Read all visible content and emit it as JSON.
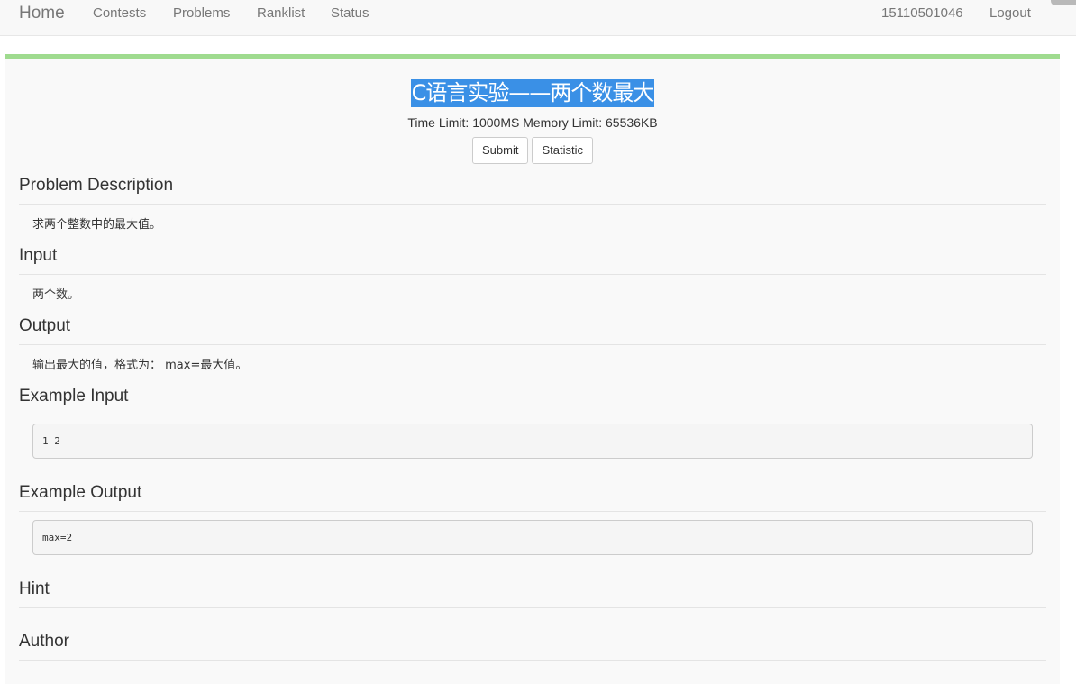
{
  "nav": {
    "brand": "Home",
    "links": [
      "Contests",
      "Problems",
      "Ranklist",
      "Status"
    ],
    "user": "15110501046",
    "logout": "Logout"
  },
  "problem": {
    "title": "C语言实验——两个数最大",
    "limits": "Time Limit: 1000MS Memory Limit: 65536KB",
    "buttons": {
      "submit": "Submit",
      "statistic": "Statistic"
    },
    "sections": {
      "description": {
        "heading": "Problem Description",
        "text": "求两个整数中的最大值。"
      },
      "input": {
        "heading": "Input",
        "text": "两个数。"
      },
      "output": {
        "heading": "Output",
        "text": "输出最大的值，格式为： max=最大值。"
      },
      "example_input": {
        "heading": "Example Input",
        "code": "1 2"
      },
      "example_output": {
        "heading": "Example Output",
        "code": "max=2"
      },
      "hint": {
        "heading": "Hint"
      },
      "author": {
        "heading": "Author"
      }
    }
  },
  "colors": {
    "accent_bar": "#9fdb8f",
    "title_highlight": "#3a90e6"
  }
}
